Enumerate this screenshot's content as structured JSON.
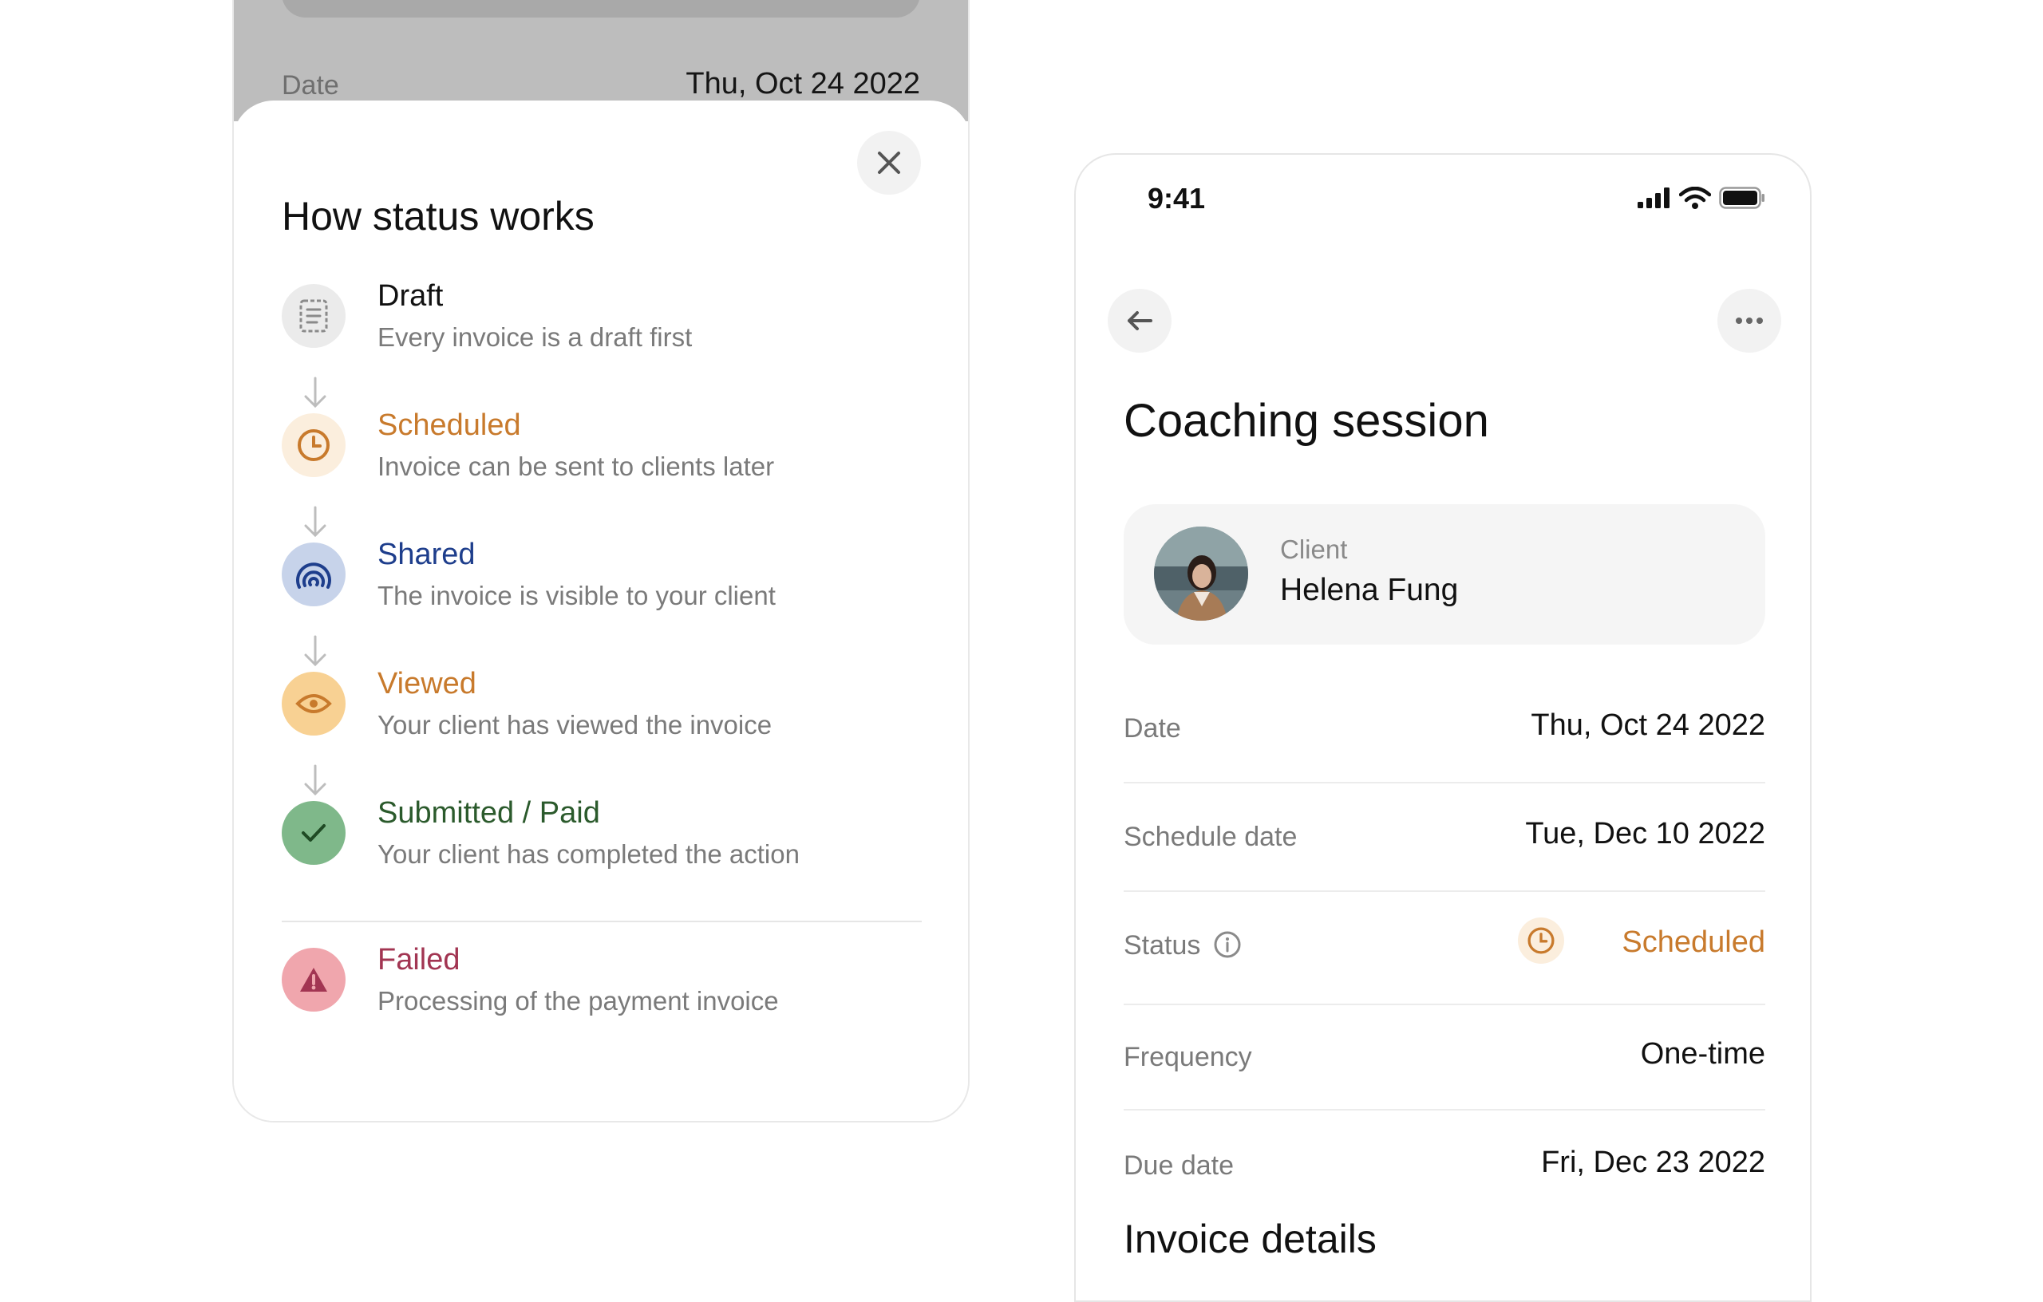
{
  "background_screen": {
    "date_label": "Date",
    "date_value": "Thu, Oct 24 2022"
  },
  "status_sheet": {
    "title": "How status works",
    "close_icon": "close-icon",
    "items": [
      {
        "name": "Draft",
        "description": "Every invoice is a draft first",
        "color": "#111111",
        "icon": "document-icon",
        "icon_bg": "#ebebeb"
      },
      {
        "name": "Scheduled",
        "description": "Invoice can be sent to clients later",
        "color": "#c87a2c",
        "icon": "clock-icon",
        "icon_bg": "#fbeedd"
      },
      {
        "name": "Shared",
        "description": "The invoice is visible to your client",
        "color": "#1e3e8c",
        "icon": "broadcast-icon",
        "icon_bg": "#c7d3ea"
      },
      {
        "name": "Viewed",
        "description": "Your client has viewed the invoice",
        "color": "#c87a2c",
        "icon": "eye-icon",
        "icon_bg": "#f8d193"
      },
      {
        "name": "Submitted / Paid",
        "description": "Your client has completed the action",
        "color": "#2b5a2c",
        "icon": "check-icon",
        "icon_bg": "#7fb88a"
      },
      {
        "name": "Failed",
        "description": "Processing of the payment invoice",
        "color": "#a23552",
        "icon": "warning-icon",
        "icon_bg": "#f0a6ad"
      }
    ]
  },
  "detail_screen": {
    "status_bar": {
      "time": "9:41",
      "icons": [
        "signal-icon",
        "wifi-icon",
        "battery-icon"
      ]
    },
    "back_icon": "back-arrow-icon",
    "more_icon": "more-icon",
    "title": "Coaching session",
    "client": {
      "label": "Client",
      "name": "Helena Fung"
    },
    "rows": [
      {
        "label": "Date",
        "value": "Thu, Oct 24 2022"
      },
      {
        "label": "Schedule date",
        "value": "Tue, Dec 10 2022"
      },
      {
        "label": "Status",
        "value": "Scheduled",
        "info_icon": "info-icon",
        "status_icon": "clock-icon",
        "color": "#c87a2c"
      },
      {
        "label": "Frequency",
        "value": "One-time"
      },
      {
        "label": "Due date",
        "value": "Fri, Dec 23 2022"
      }
    ],
    "section_title": "Invoice details"
  }
}
